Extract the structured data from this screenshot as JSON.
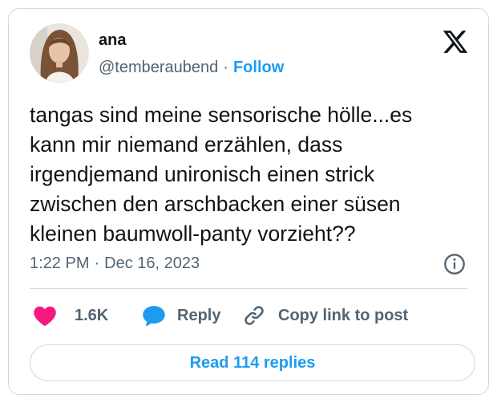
{
  "author": {
    "name": "ana",
    "handle": "@temberaubend",
    "separator": "·",
    "follow_label": "Follow"
  },
  "tweet": {
    "text_lines": [
      "tangas sind meine sensorische hölle...es",
      "kann mir niemand erzählen, dass",
      "irgendjemand unironisch einen strick",
      "zwischen den arschbacken einer süsen",
      "kleinen baumwoll-panty vorzieht??"
    ],
    "time": "1:22 PM",
    "separator": "·",
    "date": "Dec 16, 2023"
  },
  "actions": {
    "like_count": "1.6K",
    "reply_label": "Reply",
    "copy_label": "Copy link to post"
  },
  "footer": {
    "read_replies_label": "Read 114 replies"
  },
  "icons": {
    "brand": "x-logo-icon",
    "info": "info-icon",
    "like": "heart-icon",
    "reply": "speech-bubble-icon",
    "copy": "link-icon"
  },
  "colors": {
    "accent": "#1d9bf0",
    "like": "#f91880",
    "text": "#0f1419",
    "muted": "#536471",
    "border": "#cfd9de"
  }
}
